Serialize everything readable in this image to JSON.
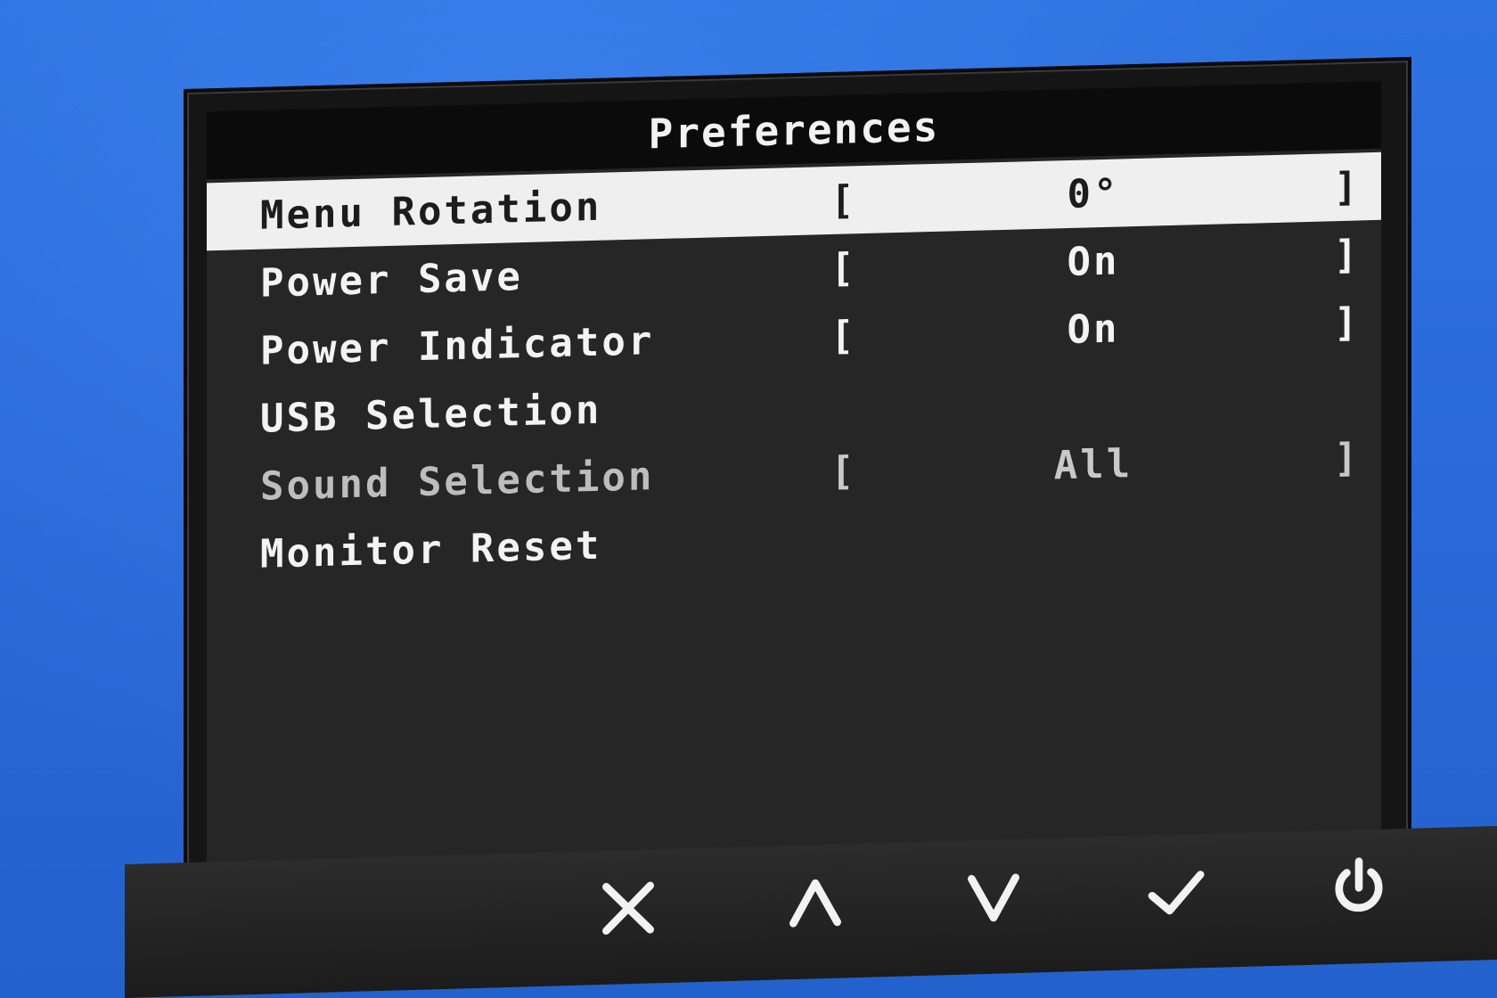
{
  "osd": {
    "title": "Preferences",
    "items": [
      {
        "label": "Menu Rotation",
        "value": "0°",
        "selected": true,
        "disabled": false,
        "has_value": true
      },
      {
        "label": "Power Save",
        "value": "On",
        "selected": false,
        "disabled": false,
        "has_value": true
      },
      {
        "label": "Power Indicator",
        "value": "On",
        "selected": false,
        "disabled": false,
        "has_value": true
      },
      {
        "label": "USB Selection",
        "value": "",
        "selected": false,
        "disabled": false,
        "has_value": false
      },
      {
        "label": "Sound Selection",
        "value": "All",
        "selected": false,
        "disabled": true,
        "has_value": true
      },
      {
        "label": "Monitor Reset",
        "value": "",
        "selected": false,
        "disabled": false,
        "has_value": false
      }
    ],
    "bracket_open": "[",
    "bracket_close": "]"
  },
  "buttons": [
    {
      "name": "close-button",
      "icon": "close-icon"
    },
    {
      "name": "up-button",
      "icon": "chevron-up-icon"
    },
    {
      "name": "down-button",
      "icon": "chevron-down-icon"
    },
    {
      "name": "confirm-button",
      "icon": "check-icon"
    },
    {
      "name": "power-button",
      "icon": "power-icon"
    }
  ],
  "colors": {
    "desktop": "#2a6ad9",
    "osd_background": "#262626",
    "title_bar": "#0b0b0b",
    "selected_row": "#efefef",
    "text": "#f3f3f3",
    "disabled_text": "#bdbdbd"
  }
}
